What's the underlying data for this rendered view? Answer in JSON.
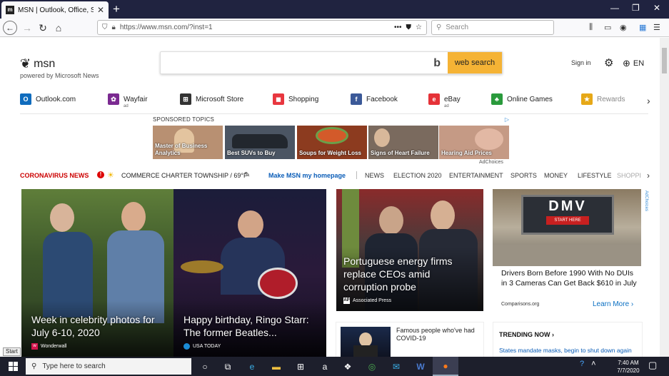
{
  "browser": {
    "tab_title": "MSN | Outlook, Office, Skype, B",
    "url": "https://www.msn.com/?inst=1",
    "search_placeholder": "Search",
    "page_actions": "•••"
  },
  "header": {
    "logo_text": "msn",
    "powered_by": "powered by Microsoft News",
    "search_button": "web search",
    "sign_in": "Sign in",
    "language": "EN"
  },
  "quicklinks": [
    {
      "label": "Outlook.com",
      "icon": "outlook-icon",
      "color": "#0f6cbd",
      "glyph": "O",
      "ad": ""
    },
    {
      "label": "Wayfair",
      "icon": "wayfair-icon",
      "color": "#7b2a91",
      "glyph": "✿",
      "ad": "ad"
    },
    {
      "label": "Microsoft Store",
      "icon": "store-icon",
      "color": "#333333",
      "glyph": "⊞",
      "ad": ""
    },
    {
      "label": "Shopping",
      "icon": "shopping-bag-icon",
      "color": "#e8373f",
      "glyph": "◼",
      "ad": ""
    },
    {
      "label": "Facebook",
      "icon": "facebook-icon",
      "color": "#3b5998",
      "glyph": "f",
      "ad": ""
    },
    {
      "label": "eBay",
      "icon": "ebay-icon",
      "color": "#e53238",
      "glyph": "e",
      "ad": "ad"
    },
    {
      "label": "Online Games",
      "icon": "games-icon",
      "color": "#2a9a3c",
      "glyph": "♣",
      "ad": ""
    },
    {
      "label": "Rewards",
      "icon": "rewards-icon",
      "color": "#e6a817",
      "glyph": "★",
      "ad": ""
    }
  ],
  "sponsored": {
    "heading": "SPONSORED TOPICS",
    "adchoices": "AdChoices",
    "items": [
      {
        "label": "Master of Business Analytics",
        "bg": "#b89072"
      },
      {
        "label": "Best SUVs to Buy",
        "bg": "#4b5563"
      },
      {
        "label": "Soups for Weight Loss",
        "bg": "#8c3b1f"
      },
      {
        "label": "Signs of Heart Failure",
        "bg": "#7a6a5e"
      },
      {
        "label": "Hearing Aid Prices",
        "bg": "#c59a85"
      }
    ]
  },
  "navrow": {
    "coronavirus": "CORONAVIRUS NEWS",
    "location": "COMMERCE CHARTER TOWNSHIP / 69°F",
    "make_home": "Make MSN my homepage",
    "categories": [
      "NEWS",
      "ELECTION 2020",
      "ENTERTAINMENT",
      "SPORTS",
      "MONEY",
      "LIFESTYLE",
      "SHOPPI"
    ]
  },
  "cards": {
    "card1": {
      "caption": "Week in celebrity photos for July 6-10, 2020",
      "source": "Wonderwall"
    },
    "card2": {
      "caption": "Happy birthday, Ringo Starr: The former Beatles...",
      "source": "USA TODAY"
    },
    "card3": {
      "caption": "Portuguese energy firms replace CEOs amid corruption probe",
      "source": "Associated Press"
    },
    "card4": {
      "caption": "Drivers Born Before 1990 With No DUIs in 3 Cameras Can Get Back $610 in July",
      "source": "Comparisons.org",
      "learn_more": "Learn More",
      "adchoices": "AdChoices",
      "sign_top": "DMV",
      "sign_mid": "START HERE"
    },
    "famous": {
      "text": "Famous people who've had COVID-19"
    },
    "trending": {
      "heading": "TRENDING NOW",
      "item": "States mandate masks, begin to shut down again"
    }
  },
  "taskbar": {
    "start_tooltip": "Start",
    "search_placeholder": "Type here to search",
    "time": "7:40 AM",
    "date": "7/7/2020"
  }
}
